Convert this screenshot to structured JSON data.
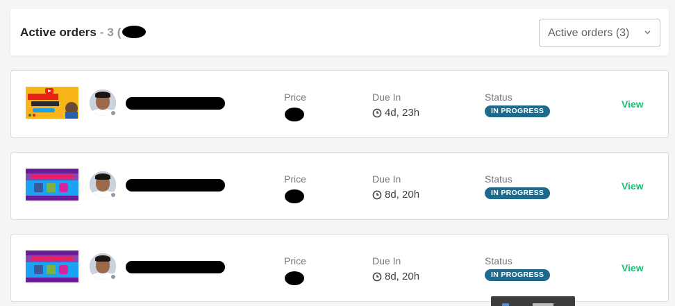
{
  "header": {
    "title": "Active orders",
    "count_text": "- 3 (",
    "dropdown_label": "Active orders (3)"
  },
  "columns": {
    "price": "Price",
    "due": "Due In",
    "status": "Status"
  },
  "orders": [
    {
      "thumbnail": "youtube-seo-gig-thumbnail",
      "due_in": "4d, 23h",
      "status": "IN PROGRESS",
      "action": "View"
    },
    {
      "thumbnail": "facebook-ads-gig-thumbnail",
      "due_in": "8d, 20h",
      "status": "IN PROGRESS",
      "action": "View"
    },
    {
      "thumbnail": "facebook-ads-gig-thumbnail",
      "due_in": "8d, 20h",
      "status": "IN PROGRESS",
      "action": "View"
    }
  ],
  "colors": {
    "accent_green": "#1dbf73",
    "badge_blue": "#1d6a8c",
    "muted_text": "#74767e"
  },
  "icons": {
    "clock": "clock-icon",
    "chevron": "chevron-down-icon"
  }
}
